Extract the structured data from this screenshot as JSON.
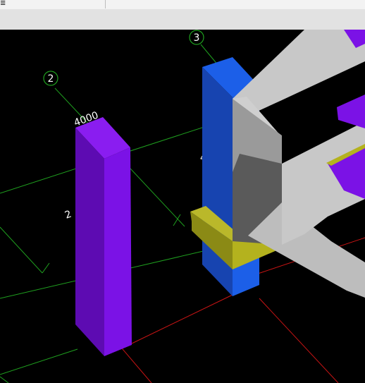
{
  "window": {
    "menu_glyph": "≣"
  },
  "viewport": {
    "background": "#000000",
    "axis_labels": {
      "axis_2": "2",
      "axis_3": "3"
    },
    "dimensions": {
      "top_length": "4000",
      "side_partial": "2",
      "hidden_partial": "4"
    }
  },
  "colors": {
    "grid": "#1fa01f",
    "axis_red": "#c81414",
    "column_purple": "#7b12e6",
    "column_blue": "#1c5fe8",
    "beam_yellow": "#b4b21e",
    "slab_gray": "#b4b4b4"
  },
  "icons": [
    "axis-bubble-icon"
  ]
}
